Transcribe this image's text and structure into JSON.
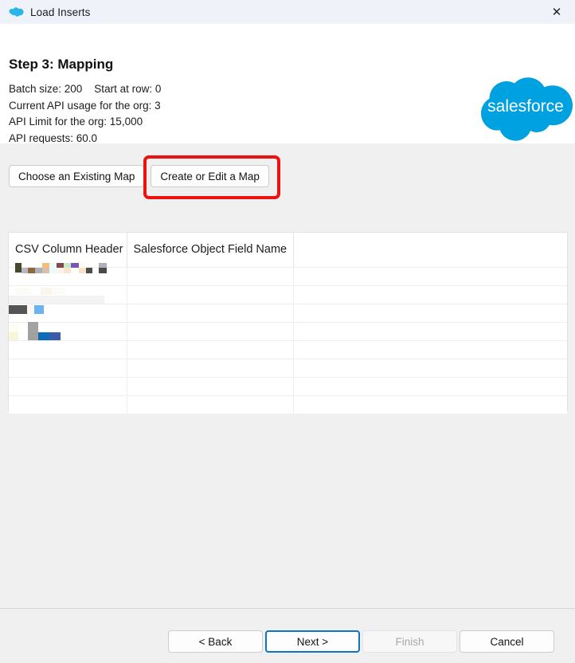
{
  "titlebar": {
    "title": "Load Inserts",
    "icon": "salesforce-cloud-icon",
    "close_label": "✕",
    "background": "#eff3f9"
  },
  "header": {
    "step_title": "Step 3: Mapping",
    "meta_lines": [
      "Batch size: 200    Start at row: 0",
      "Current API usage for the org: 3",
      "API Limit for the org: 15,000",
      "API requests: 60.0"
    ],
    "logo": {
      "wordmark": "salesforce",
      "cloud_color": "#00a1e0",
      "text_color": "#ffffff"
    }
  },
  "map_toolbar": {
    "choose_existing_label": "Choose an Existing Map",
    "create_or_edit_label": "Create or Edit a Map"
  },
  "annotation": {
    "shape": "rectangle",
    "color": "#ee1111",
    "target": "create-or-edit-a-map-button"
  },
  "mapping_table": {
    "columns": [
      "CSV Column Header",
      "Salesforce Object Field Name",
      ""
    ],
    "rows": [
      {
        "csv_column_header": "",
        "salesforce_field": "",
        "extra": "",
        "redacted": true
      },
      {
        "csv_column_header": "",
        "salesforce_field": "",
        "extra": "",
        "redacted": true
      },
      {
        "csv_column_header": "",
        "salesforce_field": "",
        "extra": "",
        "redacted": true
      },
      {
        "csv_column_header": "",
        "salesforce_field": "",
        "extra": "",
        "redacted": true
      },
      {
        "csv_column_header": "",
        "salesforce_field": "",
        "extra": "",
        "redacted": false
      },
      {
        "csv_column_header": "",
        "salesforce_field": "",
        "extra": "",
        "redacted": false
      },
      {
        "csv_column_header": "",
        "salesforce_field": "",
        "extra": "",
        "redacted": false
      },
      {
        "csv_column_header": "",
        "salesforce_field": "",
        "extra": "",
        "redacted": false
      }
    ]
  },
  "footer": {
    "back_label": "< Back",
    "next_label": "Next >",
    "finish_label": "Finish",
    "cancel_label": "Cancel",
    "focus_color": "#1273c4",
    "disabled_button": "finish"
  }
}
